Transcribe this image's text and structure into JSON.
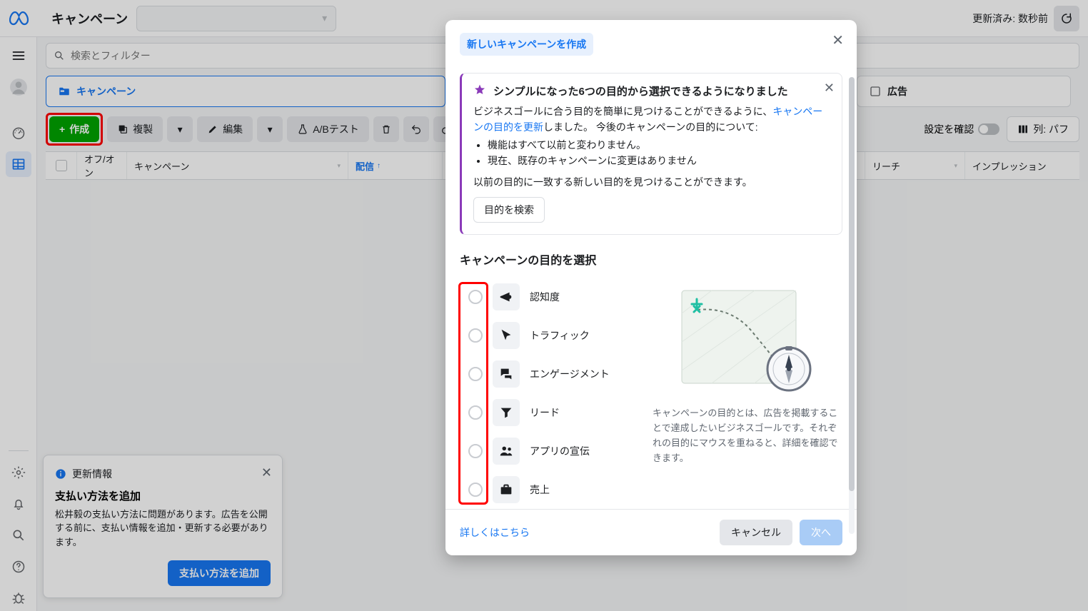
{
  "topbar": {
    "title": "キャンペーン",
    "account_placeholder": " ",
    "status": "更新済み: 数秒前"
  },
  "search": {
    "placeholder": "検索とフィルター"
  },
  "tabs": {
    "campaigns": "キャンペーン",
    "ads": "広告"
  },
  "tools": {
    "create": "作成",
    "duplicate": "複製",
    "edit": "編集",
    "abtest": "A/Bテスト",
    "settings_check": "設定を確認",
    "columns": "列: パフ"
  },
  "table": {
    "onoff": "オフ/オン",
    "campaign": "キャンペーン",
    "delivery": "配信",
    "reach": "リーチ",
    "impressions": "インプレッション"
  },
  "notif": {
    "header": "更新情報",
    "title": "支払い方法を追加",
    "body": "松井毅の支払い方法に問題があります。広告を公開する前に、支払い情報を追加・更新する必要があります。",
    "action": "支払い方法を追加"
  },
  "modal": {
    "tab": "新しいキャンペーンを作成",
    "info_title": "シンプルになった6つの目的から選択できるようになりました",
    "info_body_pre": "ビジネスゴールに合う目的を簡単に見つけることができるように、",
    "info_link": "キャンペーンの目的を更新",
    "info_body_post": "しました。 今後のキャンペーンの目的について:",
    "info_bullet1": "機能はすべて以前と変わりません。",
    "info_bullet2": "現在、既存のキャンペーンに変更はありません",
    "info_footer": "以前の目的に一致する新しい目的を見つけることができます。",
    "info_btn": "目的を検索",
    "section": "キャンペーンの目的を選択",
    "objectives": [
      {
        "label": "認知度",
        "icon": "megaphone"
      },
      {
        "label": "トラフィック",
        "icon": "cursor"
      },
      {
        "label": "エンゲージメント",
        "icon": "comments"
      },
      {
        "label": "リード",
        "icon": "funnel"
      },
      {
        "label": "アプリの宣伝",
        "icon": "users"
      },
      {
        "label": "売上",
        "icon": "briefcase"
      }
    ],
    "preview_text": "キャンペーンの目的とは、広告を掲載することで達成したいビジネスゴールです。それぞれの目的にマウスを重ねると、詳細を確認できます。",
    "learn_more": "詳しくはこちら",
    "cancel": "キャンセル",
    "next": "次へ"
  }
}
